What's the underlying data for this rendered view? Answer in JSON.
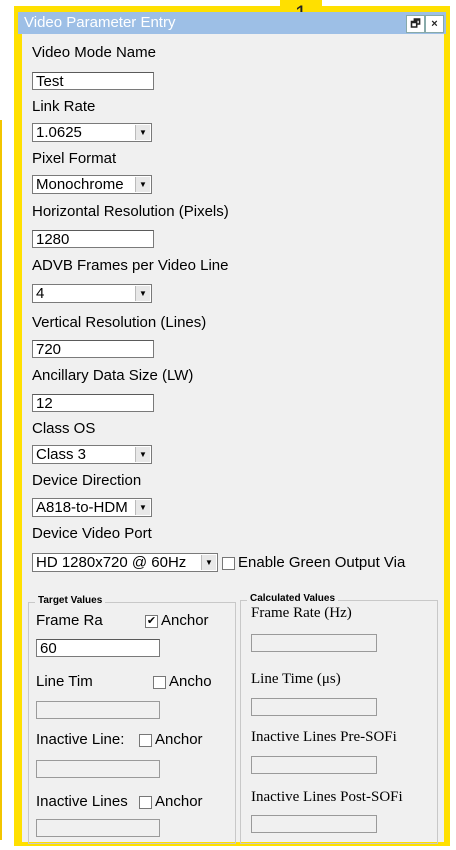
{
  "window": {
    "title": "Video Parameter Entry",
    "badge": "1",
    "restore_glyph": "🗗",
    "close_glyph": "×"
  },
  "fields": {
    "video_mode_name": {
      "label": "Video Mode Name",
      "value": "Test"
    },
    "link_rate": {
      "label": "Link Rate",
      "value": "1.0625"
    },
    "pixel_format": {
      "label": "Pixel Format",
      "value": "Monochrome"
    },
    "horizontal_resolution": {
      "label": "Horizontal Resolution (Pixels)",
      "value": "1280"
    },
    "advb_frames": {
      "label": "ADVB Frames per Video Line",
      "value": "4"
    },
    "vertical_resolution": {
      "label": "Vertical Resolution (Lines)",
      "value": "720"
    },
    "ancillary_size": {
      "label": "Ancillary Data Size (LW)",
      "value": "12"
    },
    "class_os": {
      "label": "Class OS",
      "value": "Class 3"
    },
    "device_direction": {
      "label": "Device Direction",
      "value": "A818-to-HDM"
    },
    "device_video_port": {
      "label": "Device Video Port",
      "value": "HD 1280x720 @ 60Hz"
    },
    "enable_green": {
      "label": "Enable Green Output Via",
      "checked": false
    }
  },
  "target": {
    "title": "Target Values",
    "rows": [
      {
        "label": "Frame Ra",
        "anchor": "Anchor",
        "checked": true,
        "value": "60"
      },
      {
        "label": "Line Tim",
        "anchor": "Ancho",
        "checked": false,
        "value": ""
      },
      {
        "label": "Inactive Line:",
        "anchor": "Anchor",
        "checked": false,
        "value": ""
      },
      {
        "label": "Inactive Lines",
        "anchor": "Anchor",
        "checked": false,
        "value": ""
      }
    ]
  },
  "calculated": {
    "title": "Calculated Values",
    "rows": [
      {
        "label": "Frame Rate (Hz)",
        "value": ""
      },
      {
        "label": "Line Time (μs)",
        "value": ""
      },
      {
        "label": "Inactive Lines Pre-SOFi",
        "value": ""
      },
      {
        "label": "Inactive Lines Post-SOFi",
        "value": ""
      }
    ]
  },
  "colors": {
    "highlight": "#ffe000",
    "titlebar": "#9dbfe6",
    "panel_bg": "#f0f0f0"
  }
}
